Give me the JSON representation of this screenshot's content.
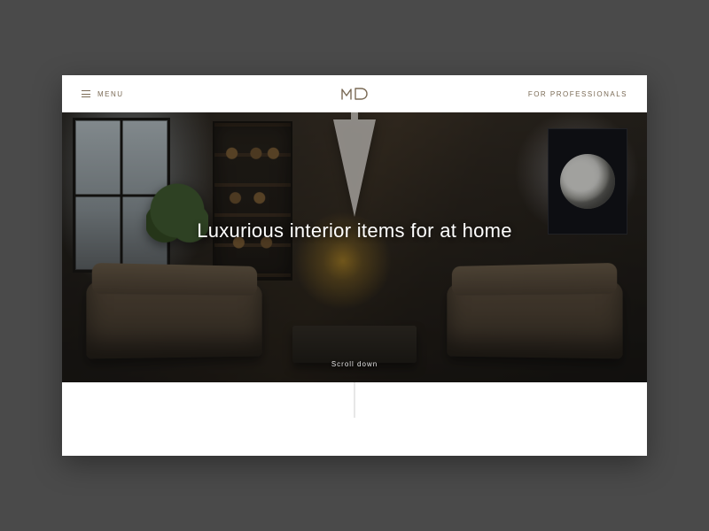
{
  "header": {
    "menu_label": "MENU",
    "logo_text": "MD",
    "pro_link_label": "FOR PROFESSIONALS"
  },
  "hero": {
    "headline": "Luxurious interior items for at home",
    "scroll_hint": "Scroll down"
  },
  "colors": {
    "accent": "#7a6a55"
  }
}
